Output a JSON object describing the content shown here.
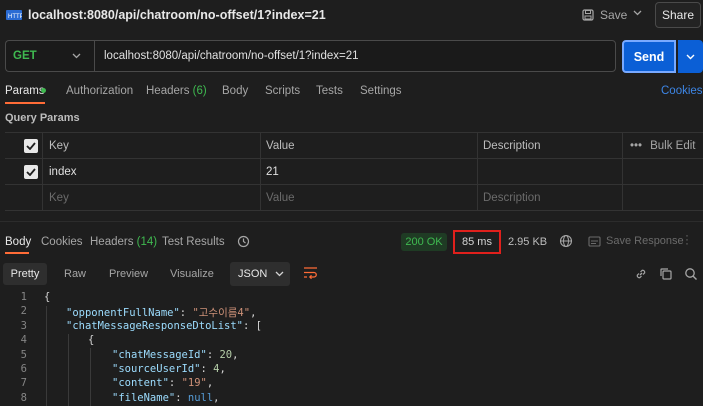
{
  "window": {
    "tab_title": "localhost:8080/api/chatroom/no-offset/1?index=21",
    "save_label": "Save",
    "share_label": "Share"
  },
  "request": {
    "method": "GET",
    "url": "localhost:8080/api/chatroom/no-offset/1?index=21",
    "send_label": "Send"
  },
  "request_tabs": {
    "params": "Params",
    "authorization": "Authorization",
    "headers": "Headers",
    "headers_count": "(6)",
    "body": "Body",
    "scripts": "Scripts",
    "tests": "Tests",
    "settings": "Settings",
    "cookies": "Cookies"
  },
  "query_params": {
    "title": "Query Params",
    "columns": {
      "key": "Key",
      "value": "Value",
      "description": "Description",
      "bulk_edit": "Bulk Edit"
    },
    "rows": [
      {
        "key": "index",
        "value": "21",
        "description": ""
      }
    ],
    "placeholder": {
      "key": "Key",
      "value": "Value",
      "description": "Description"
    }
  },
  "response": {
    "tabs": {
      "body": "Body",
      "cookies": "Cookies",
      "headers": "Headers",
      "headers_count": "(14)",
      "test_results": "Test Results"
    },
    "status": "200 OK",
    "time": "85 ms",
    "size": "2.95 KB",
    "save_response": "Save Response",
    "formats": {
      "pretty": "Pretty",
      "raw": "Raw",
      "preview": "Preview",
      "visualize": "Visualize"
    },
    "language": "JSON",
    "code_lines": [
      {
        "n": "1",
        "indent": 0,
        "text": "{"
      },
      {
        "n": "2",
        "indent": 1,
        "key": "\"opponentFullName\"",
        "sep": ": ",
        "val": "\"고수이름4\"",
        "tail": ","
      },
      {
        "n": "3",
        "indent": 1,
        "key": "\"chatMessageResponseDtoList\"",
        "sep": ": ",
        "val": "",
        "tail": "["
      },
      {
        "n": "4",
        "indent": 2,
        "text": "{"
      },
      {
        "n": "5",
        "indent": 3,
        "key": "\"chatMessageId\"",
        "sep": ": ",
        "num": "20",
        "tail": ","
      },
      {
        "n": "6",
        "indent": 3,
        "key": "\"sourceUserId\"",
        "sep": ": ",
        "num": "4",
        "tail": ","
      },
      {
        "n": "7",
        "indent": 3,
        "key": "\"content\"",
        "sep": ": ",
        "val": "\"19\"",
        "tail": ","
      },
      {
        "n": "8",
        "indent": 3,
        "key": "\"fileName\"",
        "sep": ": ",
        "kw": "null",
        "tail": ","
      }
    ]
  },
  "colors": {
    "accent_orange": "#ff6c37",
    "send_blue": "#0b5fd6",
    "status_green": "#3fb950",
    "highlight_red": "#e0201c",
    "json_key": "#9cdcfe",
    "json_string": "#ce9178",
    "json_number": "#b5cea8",
    "json_keyword": "#569cd6"
  }
}
